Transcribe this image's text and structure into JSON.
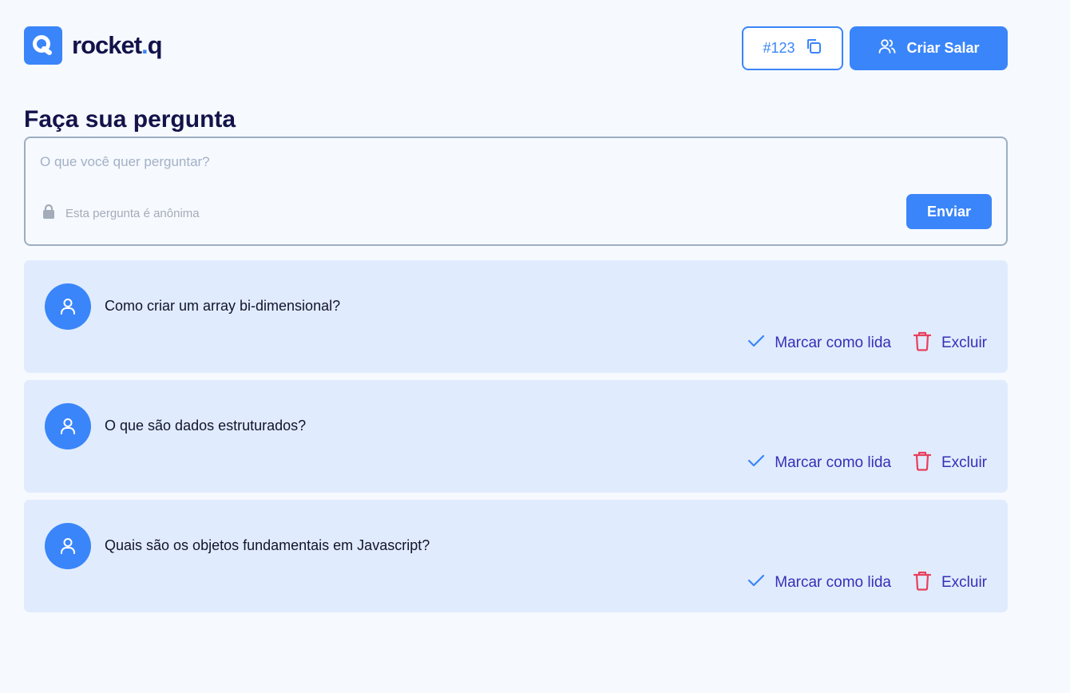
{
  "logo": {
    "name": "rocket",
    "dot": ".",
    "suffix": "q"
  },
  "header": {
    "room_code": "#123",
    "create_room_label": "Criar Salar"
  },
  "ask": {
    "title": "Faça sua pergunta",
    "placeholder": "O que você quer perguntar?",
    "anonymous_label": "Esta pergunta é anônima",
    "send_label": "Enviar"
  },
  "questions": [
    {
      "text": "Como criar um array bi-dimensional?",
      "mark_read_label": "Marcar como lida",
      "delete_label": "Excluir"
    },
    {
      "text": "O que são dados estruturados?",
      "mark_read_label": "Marcar como lida",
      "delete_label": "Excluir"
    },
    {
      "text": "Quais são os objetos fundamentais em Javascript?",
      "mark_read_label": "Marcar como lida",
      "delete_label": "Excluir"
    }
  ],
  "icons": {
    "logo": "magnifier-logo-icon",
    "copy": "copy-icon",
    "users": "users-icon",
    "lock": "lock-icon",
    "user": "user-icon",
    "check": "check-icon",
    "trash": "trash-icon"
  },
  "colors": {
    "primary": "#3A85F9",
    "background": "#F6F9FE",
    "question_bg": "#E0ECFD",
    "title": "#13134A",
    "action_text": "#3530B8",
    "delete_icon": "#E83F5B",
    "muted": "#A3ACB8"
  }
}
